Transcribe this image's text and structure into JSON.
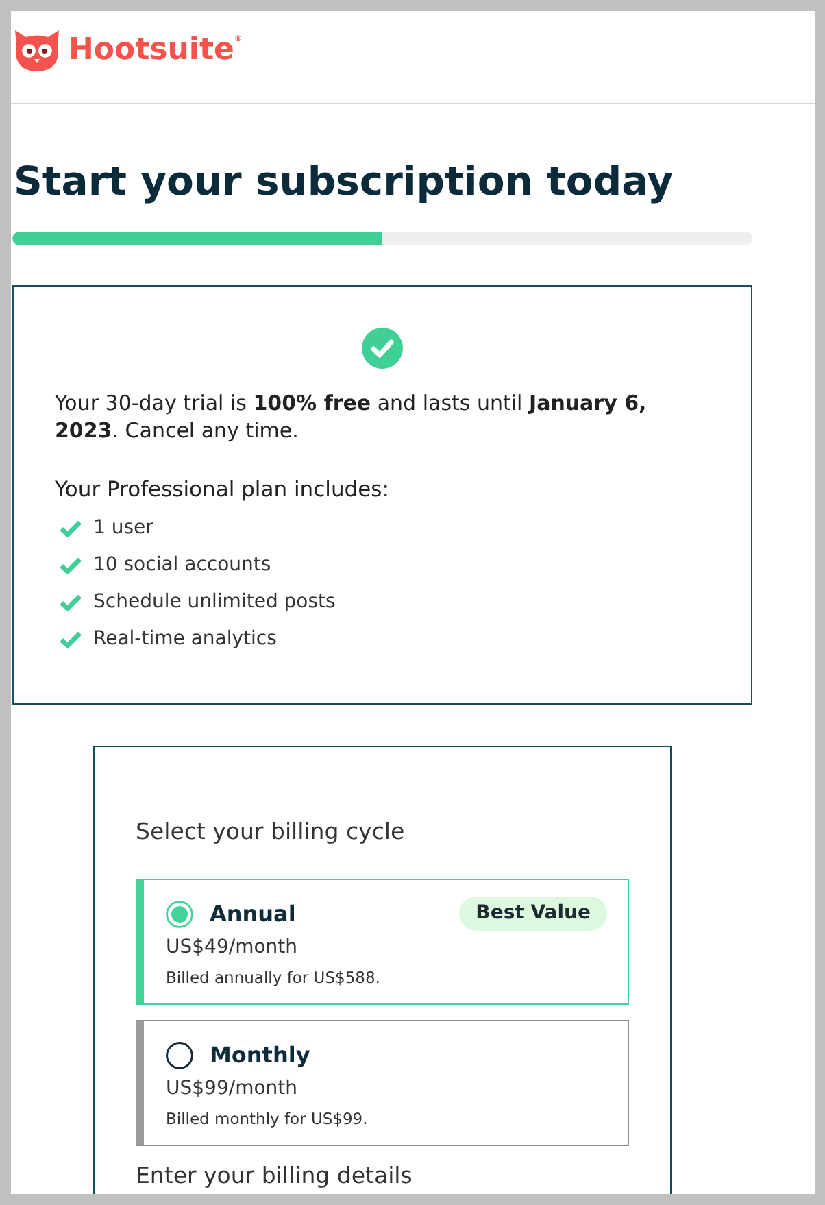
{
  "header": {
    "brand": "Hootsuite$^{®}$"
  },
  "title": "Start your subscription today",
  "progress": {
    "level": 0.5
  },
  "trial": {
    "message": "Your 30-day trial is **100% free** and lasts until **January 6, 2023**. Cancel any time.",
    "plan_heading": "Your Professional plan includes:",
    "features": [
      "1 user",
      "10 social accounts",
      "Schedule unlimited posts",
      "Real-time analytics"
    ]
  },
  "billing": {
    "heading": "Select your billing cycle",
    "options": [
      {
        "name": "Annual",
        "selected": true,
        "badge": "Best Value",
        "price": "US$49/month",
        "note": "Billed annually for US$588."
      },
      {
        "name": "Monthly",
        "selected": false,
        "price": "US$99/month",
        "note": "Billed monthly for US$99."
      }
    ],
    "details_heading": "Enter your billing details"
  }
}
